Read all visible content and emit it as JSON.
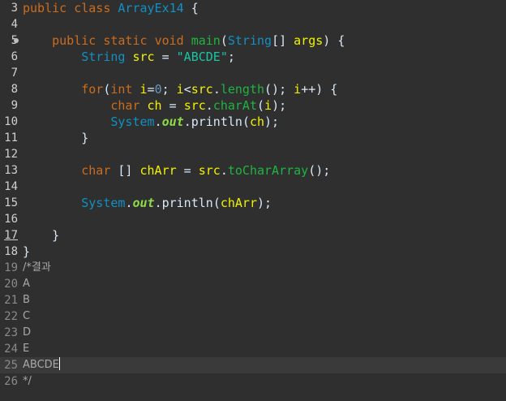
{
  "gutter": {
    "line_numbers": [
      "3",
      "4",
      "5",
      "6",
      "7",
      "8",
      "9",
      "10",
      "11",
      "12",
      "13",
      "14",
      "15",
      "16",
      "17",
      "18",
      "19",
      "20",
      "21",
      "22",
      "23",
      "24",
      "25",
      "26"
    ]
  },
  "code": {
    "l3": {
      "kw1": "public",
      "kw2": "class",
      "classname": "ArrayEx14",
      "brace": "{"
    },
    "l5": {
      "kw1": "public",
      "kw2": "static",
      "kw3": "void",
      "method": "main",
      "p1": "(",
      "type": "String",
      "p2": "[] ",
      "param": "args",
      "p3": ") {"
    },
    "l6": {
      "type": "String",
      "var": "src",
      "eq": " = ",
      "str": "\"ABCDE\"",
      "semi": ";"
    },
    "l8": {
      "kw1": "for",
      "p1": "(",
      "kw2": "int",
      "var1": "i",
      "p2": "=",
      "num": "0",
      "p3": "; ",
      "var2": "i",
      "p4": "<",
      "var3": "src",
      "p5": ".",
      "method": "length",
      "p6": "(); ",
      "var4": "i",
      "p7": "++) {"
    },
    "l9": {
      "kw1": "char",
      "var1": "ch",
      "eq": " = ",
      "var2": "src",
      "dot": ".",
      "method": "charAt",
      "p1": "(",
      "var3": "i",
      "p2": ");"
    },
    "l10": {
      "type": "System",
      "dot1": ".",
      "field": "out",
      "dot2": ".",
      "method": "println",
      "p1": "(",
      "var": "ch",
      "p2": ");"
    },
    "l11": {
      "brace": "}"
    },
    "l13": {
      "kw1": "char",
      "p1": " [] ",
      "var1": "chArr",
      "eq": " = ",
      "var2": "src",
      "dot": ".",
      "method": "toCharArray",
      "p2": "();"
    },
    "l15": {
      "type": "System",
      "dot1": ".",
      "field": "out",
      "dot2": ".",
      "method": "println",
      "p1": "(",
      "var": "chArr",
      "p2": ");"
    },
    "l17": {
      "brace": "}"
    },
    "l18": {
      "brace": "}"
    },
    "l19": {
      "text": "/*결과"
    },
    "l20": {
      "text": "A"
    },
    "l21": {
      "text": "B"
    },
    "l22": {
      "text": "C"
    },
    "l23": {
      "text": "D"
    },
    "l24": {
      "text": "E"
    },
    "l25": {
      "text": "ABCDE"
    },
    "l26": {
      "text": "*/"
    }
  }
}
